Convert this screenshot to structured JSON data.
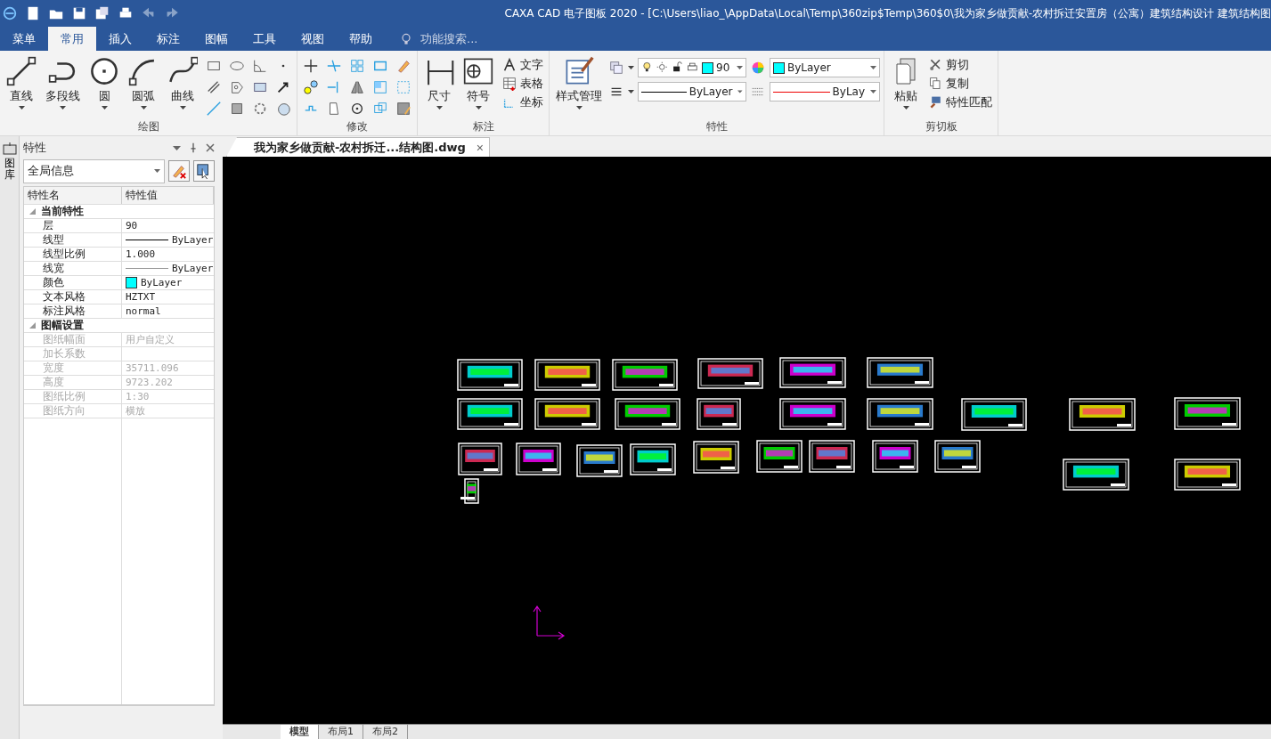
{
  "title_bar": {
    "title": "CAXA CAD 电子图板 2020 - [C:\\Users\\liao_\\AppData\\Local\\Temp\\360zip$Temp\\360$0\\我为家乡做贡献-农村拆迁安置房（公寓）建筑结构设计 建筑结构图"
  },
  "menu_tabs": [
    {
      "label": "菜单",
      "selected": false
    },
    {
      "label": "常用",
      "selected": true
    },
    {
      "label": "插入",
      "selected": false
    },
    {
      "label": "标注",
      "selected": false
    },
    {
      "label": "图幅",
      "selected": false
    },
    {
      "label": "工具",
      "selected": false
    },
    {
      "label": "视图",
      "selected": false
    },
    {
      "label": "帮助",
      "selected": false
    }
  ],
  "search": {
    "placeholder": "功能搜索..."
  },
  "ribbon": {
    "draw": {
      "label": "绘图",
      "buttons": [
        {
          "label": "直线"
        },
        {
          "label": "多段线"
        },
        {
          "label": "圆"
        },
        {
          "label": "圆弧"
        },
        {
          "label": "曲线"
        }
      ]
    },
    "modify": {
      "label": "修改"
    },
    "annotate": {
      "label": "标注",
      "buttons": [
        {
          "label": "尺寸"
        },
        {
          "label": "符号"
        }
      ],
      "small_buttons": [
        {
          "label": "文字"
        },
        {
          "label": "表格"
        },
        {
          "label": "坐标"
        }
      ]
    },
    "properties": {
      "label": "特性",
      "style_button": "样式管理",
      "layer": "90",
      "color_value": "ByLayer",
      "linetype": "ByLayer",
      "lineweight": "ByLay"
    },
    "clipboard": {
      "label": "剪切板",
      "paste": "粘贴",
      "small_buttons": [
        {
          "label": "剪切"
        },
        {
          "label": "复制"
        },
        {
          "label": "特性匹配"
        }
      ]
    }
  },
  "side_tab": {
    "label": "图库"
  },
  "panel": {
    "title": "特性",
    "selector": "全局信息",
    "columns": [
      "特性名",
      "特性值"
    ],
    "sections": [
      {
        "label": "当前特性",
        "expanded": true,
        "rows": [
          {
            "name": "层",
            "value": "90",
            "kind": "text",
            "disabled": false
          },
          {
            "name": "线型",
            "value": "ByLayer",
            "kind": "line",
            "disabled": false
          },
          {
            "name": "线型比例",
            "value": "1.000",
            "kind": "text",
            "disabled": false
          },
          {
            "name": "线宽",
            "value": "ByLayer",
            "kind": "thinline",
            "disabled": false
          },
          {
            "name": "颜色",
            "value": "ByLayer",
            "kind": "color",
            "color": "#00ffff",
            "disabled": false
          },
          {
            "name": "文本风格",
            "value": "HZTXT",
            "kind": "text",
            "disabled": false
          },
          {
            "name": "标注风格",
            "value": "normal",
            "kind": "text",
            "disabled": false
          }
        ]
      },
      {
        "label": "图幅设置",
        "expanded": true,
        "rows": [
          {
            "name": "图纸幅面",
            "value": "用户自定义",
            "kind": "text",
            "disabled": true
          },
          {
            "name": "加长系数",
            "disabled": true
          },
          {
            "name": "宽度",
            "value": "35711.096",
            "kind": "text",
            "disabled": true
          },
          {
            "name": "高度",
            "value": "9723.202",
            "kind": "text",
            "disabled": true
          },
          {
            "name": "图纸比例",
            "value": "1:30",
            "kind": "text",
            "disabled": true
          },
          {
            "name": "图纸方向",
            "value": "横放",
            "kind": "text",
            "disabled": true
          }
        ]
      }
    ]
  },
  "document_tabs": [
    {
      "label": "我为家乡做贡献-农村拆迁...结构图.dwg",
      "close": "×",
      "selected": true
    }
  ],
  "layout_tabs": [
    {
      "label": "模型",
      "selected": true
    },
    {
      "label": "布局1",
      "selected": false
    },
    {
      "label": "布局2",
      "selected": false
    }
  ]
}
